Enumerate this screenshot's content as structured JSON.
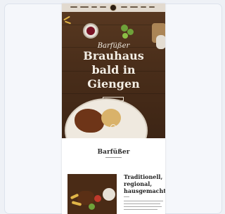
{
  "hero": {
    "script_logo": "Barfüßer",
    "headline_lines": [
      "Brauhaus",
      "bald in",
      "Giengen"
    ]
  },
  "section": {
    "brand": "Barfüßer",
    "subheading_lines": [
      "Traditionell,",
      "regional,",
      "hausgemacht"
    ]
  },
  "colors": {
    "page_bg": "#eef1f6",
    "hero_wood": "#4a2e1a",
    "headline": "#f4efe6",
    "text_dark": "#1f1f1f"
  }
}
